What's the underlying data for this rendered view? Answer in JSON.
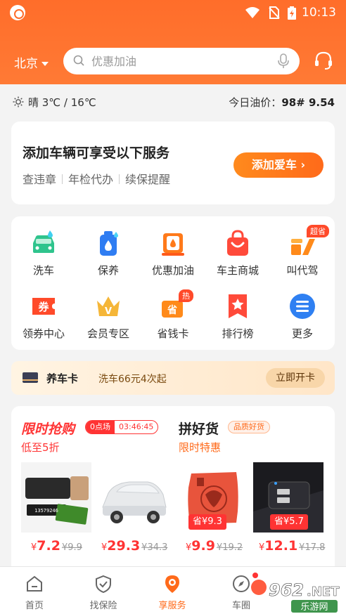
{
  "status_bar": {
    "time": "10:13"
  },
  "top_bar": {
    "city": "北京",
    "search_placeholder": "优惠加油"
  },
  "info_row": {
    "weather": "晴 3℃ / 16℃",
    "oil_label": "今日油价：",
    "oil_value": "98# 9.54"
  },
  "add_car_card": {
    "title": "添加车辆可享受以下服务",
    "services": [
      "查违章",
      "年检代办",
      "续保提醒"
    ],
    "button": "添加爱车 ›"
  },
  "services_grid": [
    {
      "label": "洗车",
      "icon": "car-wash-icon",
      "badge": ""
    },
    {
      "label": "保养",
      "icon": "maintenance-icon",
      "badge": ""
    },
    {
      "label": "优惠加油",
      "icon": "fuel-icon",
      "badge": ""
    },
    {
      "label": "车主商城",
      "icon": "shopping-bag-icon",
      "badge": ""
    },
    {
      "label": "叫代驾",
      "icon": "designated-driver-icon",
      "badge": "超省"
    },
    {
      "label": "领券中心",
      "icon": "coupon-icon",
      "badge": ""
    },
    {
      "label": "会员专区",
      "icon": "vip-crown-icon",
      "badge": ""
    },
    {
      "label": "省钱卡",
      "icon": "save-card-icon",
      "badge": "热"
    },
    {
      "label": "排行榜",
      "icon": "ranking-icon",
      "badge": ""
    },
    {
      "label": "更多",
      "icon": "more-icon",
      "badge": ""
    }
  ],
  "car_card_banner": {
    "title": "养车卡",
    "desc": "洗车66元4次起",
    "button": "立即开卡"
  },
  "flash_sale": {
    "title": "限时抢购",
    "session": "0点场",
    "countdown": "03:46:45",
    "subtitle": "低至5折"
  },
  "group_buy": {
    "title": "拼好货",
    "tag": "品质好货",
    "subtitle": "限时特惠"
  },
  "products": [
    {
      "name": "parking-number-plate",
      "price": "7.2",
      "old_price": "¥9.9",
      "save_tag": ""
    },
    {
      "name": "car-sunshade-cover",
      "price": "29.3",
      "old_price": "¥34.3",
      "save_tag": ""
    },
    {
      "name": "bamboo-charcoal-bag",
      "price": "9.9",
      "old_price": "¥19.2",
      "save_tag": "省¥9.3"
    },
    {
      "name": "car-usb-charger",
      "price": "12.1",
      "old_price": "¥17.8",
      "save_tag": "省¥5.7"
    }
  ],
  "currency": "¥",
  "tab_bar": [
    {
      "label": "首页",
      "icon": "home-icon",
      "active": false
    },
    {
      "label": "找保险",
      "icon": "shield-icon",
      "active": false
    },
    {
      "label": "享服务",
      "icon": "location-pin-icon",
      "active": true
    },
    {
      "label": "车圈",
      "icon": "compass-icon",
      "active": false
    }
  ],
  "watermark": {
    "text": "962.NET",
    "sub": "乐游网"
  },
  "colors": {
    "brand_orange": "#ff6d2a",
    "sale_red": "#ff3333"
  }
}
